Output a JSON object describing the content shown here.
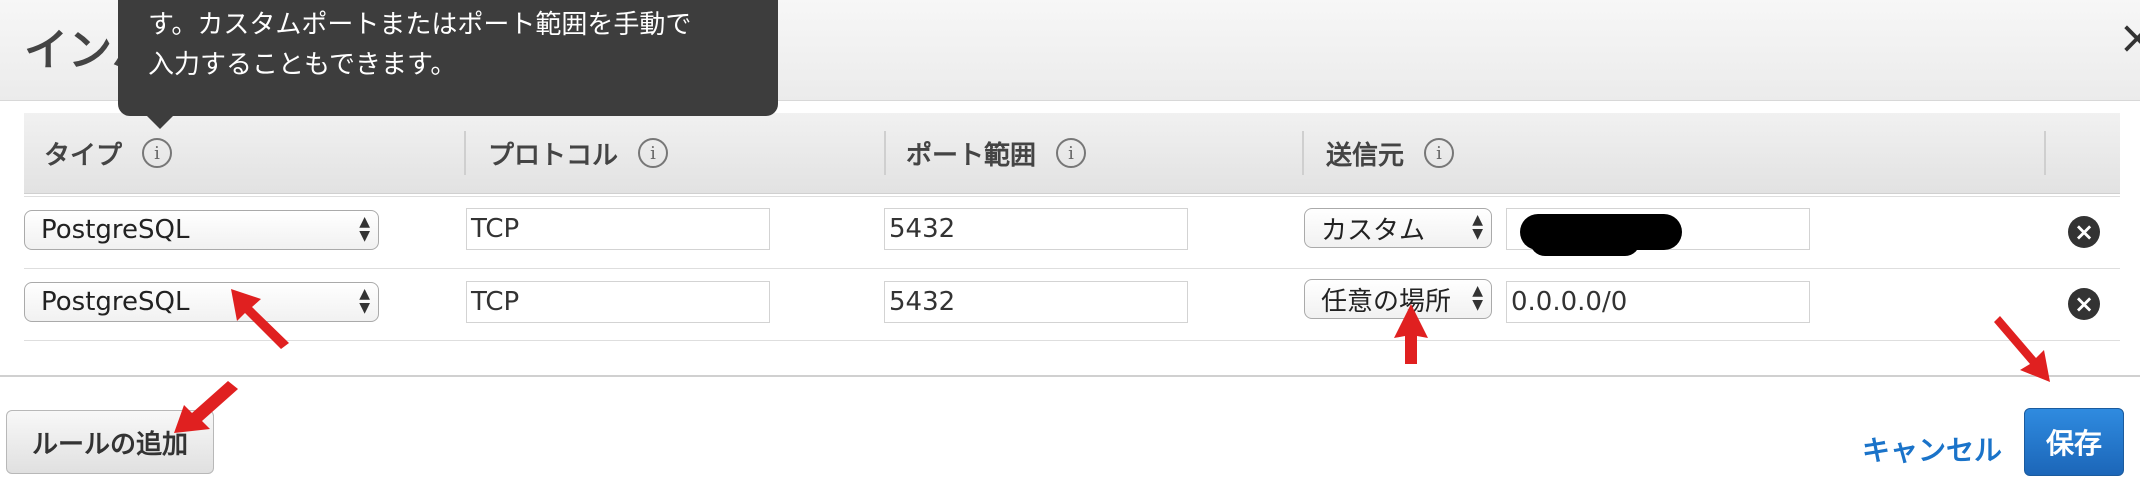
{
  "modal": {
    "title": "インバウンドのルールの編集",
    "close_icon": "×"
  },
  "tooltip": {
    "line1": "す。カスタムポートまたはポート範囲を手動で",
    "line2": "入力することもできます。"
  },
  "table": {
    "headers": [
      "タイプ",
      "プロトコル",
      "ポート範囲",
      "送信元"
    ],
    "rows": [
      {
        "type": "PostgreSQL",
        "protocol": "TCP",
        "port": "5432",
        "source_mode": "カスタム",
        "source_value": ""
      },
      {
        "type": "PostgreSQL",
        "protocol": "TCP",
        "port": "5432",
        "source_mode": "任意の場所",
        "source_value": "0.0.0.0/0"
      }
    ]
  },
  "footer": {
    "add_rule_label": "ルールの追加",
    "cancel_label": "キャンセル",
    "save_label": "保存"
  },
  "colors": {
    "accent": "#1a73c9",
    "save_button": "#2478cf",
    "annotation_arrow": "#e02020",
    "tooltip_bg": "#3d3d3d"
  },
  "icons": {
    "info": "info-icon",
    "remove": "close-circle-icon",
    "close": "close-icon",
    "select_arrows": "updown-arrows-icon"
  }
}
